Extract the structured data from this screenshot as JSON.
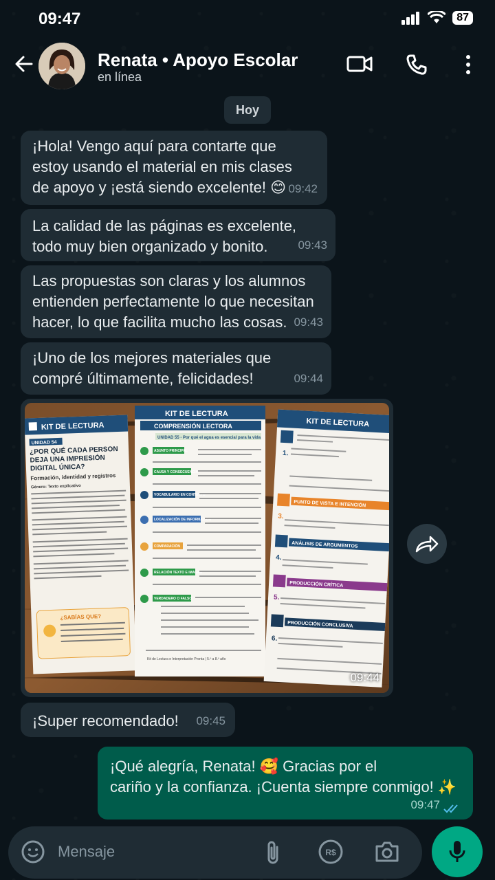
{
  "statusbar": {
    "time": "09:47",
    "battery": "87"
  },
  "header": {
    "name": "Renata • Apoyo Escolar",
    "status": "en línea"
  },
  "date_separator": "Hoy",
  "messages": [
    {
      "text": "¡Hola! Vengo aquí para contarte que\nestoy usando el material en mis clases\nde apoyo y ¡está siendo excelente! 😊",
      "time": "09:42"
    },
    {
      "text": "La calidad de las páginas es excelente,\ntodo muy bien organizado y bonito.",
      "time": "09:43"
    },
    {
      "text": "Las propuestas son claras y los alumnos\nentienden perfectamente lo que necesitan\nhacer, lo que facilita mucho las cosas.",
      "time": "09:43"
    },
    {
      "text": "¡Uno de los mejores materiales que\ncompré últimamente, felicidades!",
      "time": "09:44"
    },
    {
      "text": "¡Super recomendado!",
      "time": "09:45"
    }
  ],
  "image_message": {
    "time": "09:44",
    "sheet1": {
      "title": "KIT DE LECTURA",
      "unit": "UNIDAD 54",
      "heading": "¿POR QUÉ CADA PERSON\nDEJA UNA IMPRESIÓN\nDIGITAL ÚNICA?",
      "subheading": "Formación, identidad y registros",
      "genre": "Género: Texto explicativo",
      "box_title": "¿SABÍAS QUE?",
      "box_text": "La ciencia forense usa las huellas\ndactilares para ayudar a identificar\npersonas en escenas de crímenes\ny en la búsqueda de desaparecidos."
    },
    "sheet2": {
      "title": "KIT DE LECTURA",
      "subtitle": "COMPRENSIÓN LECTORA",
      "unit": "UNIDAD 55 - Por qué el agua es esencial para la vida",
      "items": [
        "ASUNTO PRINCIPAL",
        "CAUSA Y CONSECUENCIA",
        "VOCABULARIO EN CONTEXTO",
        "LOCALIZACIÓN DE INFORMACIÓN",
        "COMPARACIÓN",
        "RELACIÓN TEXTO E IMAGEN",
        "VERDADERO O FALSO"
      ],
      "footer": "Kit de Lectura e Interpretación Pronta | 5.º a 8.º año"
    },
    "sheet3": {
      "title": "KIT DE LECTURA",
      "sections": [
        "PUNTO DE VISTA E INTENCIÓN",
        "ANÁLISIS DE ARGUMENTOS",
        "PRODUCCIÓN CRÍTICA",
        "PRODUCCIÓN CONCLUSIVA"
      ],
      "q1": "1. De acuerdo con el texto,\n¿cuál es la idea central?",
      "q3": "3. El texto sugiere que el riesgo tiene un papel importante porque:",
      "q4": "4. De acuerdo con el texto, ¿qué beneficios trae el agua para la vida?",
      "q5": "5. ¿Estás de acuerdo en que el riesgo debería ser más valorado en la sociedad? Justifica tu respuesta.",
      "q6": "6. Escribe una pequeña conclusión (3 a 4 líneas) sobre lo que aprendiste del texto y cómo puede ayudarte."
    }
  },
  "outgoing": {
    "text": "¡Qué alegría, Renata! 🥰 Gracias por el\ncariño y la confianza. ¡Cuenta siempre conmigo! ✨",
    "time": "09:47"
  },
  "input": {
    "placeholder": "Mensaje"
  },
  "colors": {
    "accent": "#00a884",
    "incoming": "#1f2c34",
    "outgoing": "#005c4b",
    "background": "#0b141a",
    "read_ticks": "#53bdeb"
  }
}
